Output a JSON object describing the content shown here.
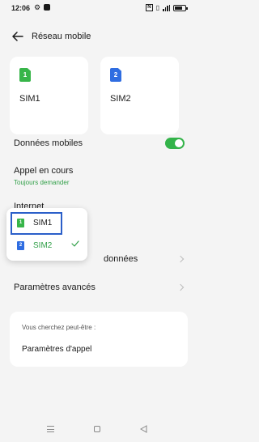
{
  "status_bar": {
    "time": "12:06"
  },
  "header": {
    "title": "Réseau mobile"
  },
  "sim_cards": [
    {
      "number": "1",
      "label": "SIM1",
      "color": "#37b549"
    },
    {
      "number": "2",
      "label": "SIM2",
      "color": "#2f6de1"
    }
  ],
  "rows": {
    "mobile_data": {
      "label": "Données mobiles",
      "enabled": true
    },
    "in_call": {
      "label": "Appel en cours",
      "sub": "Toujours demander"
    },
    "internet": {
      "label": "Internet"
    },
    "data_usage": {
      "label_fragment": "données"
    },
    "advanced": {
      "label": "Paramètres avancés"
    }
  },
  "sim_popup": {
    "options": [
      {
        "number": "1",
        "label": "SIM1"
      },
      {
        "number": "2",
        "label": "SIM2",
        "selected": true
      }
    ]
  },
  "suggestions": {
    "title": "Vous cherchez peut-être :",
    "item": "Paramètres d'appel"
  },
  "colors": {
    "accent_green": "#33b349",
    "highlight_blue": "#2b5fc9"
  }
}
